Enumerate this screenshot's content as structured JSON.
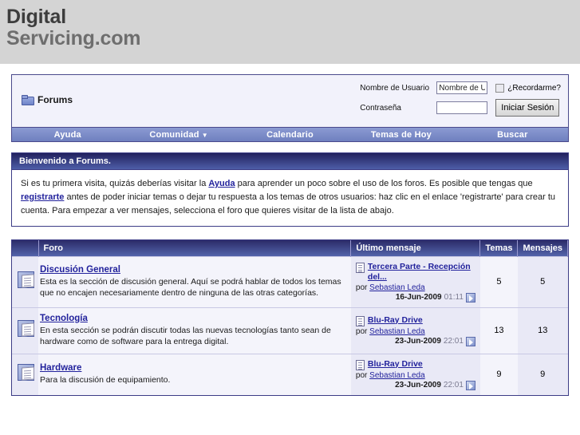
{
  "site": {
    "logo_line1": "Digital",
    "logo_line2": "Servicing.com"
  },
  "header": {
    "forums_label": "Forums",
    "folder_icon": "folder-icon"
  },
  "login": {
    "username_label": "Nombre de Usuario",
    "username_value": "Nombre de U",
    "username_placeholder": "Nombre de Usuario",
    "password_label": "Contraseña",
    "password_value": "",
    "remember_label": "¿Recordarme?",
    "submit_label": "Iniciar Sesión"
  },
  "nav": {
    "items": [
      {
        "label": "Ayuda",
        "caret": ""
      },
      {
        "label": "Comunidad",
        "caret": "▼"
      },
      {
        "label": "Calendario",
        "caret": ""
      },
      {
        "label": "Temas de Hoy",
        "caret": ""
      },
      {
        "label": "Buscar",
        "caret": ""
      }
    ]
  },
  "welcome": {
    "title": "Bienvenido a Forums.",
    "text_1": "Si es tu primera visita, quizás deberías visitar la ",
    "link_ayuda": "Ayuda",
    "text_2": " para aprender un poco sobre el uso de los foros. Es posible que tengas que ",
    "link_registrarte": "registrarte",
    "text_3": " antes de poder iniciar temas o dejar tu respuesta a los temas de otros usuarios: haz clic en el enlace 'registrarte' para crear tu cuenta. Para empezar a ver mensajes, selecciona el foro que quieres visitar de la lista de abajo."
  },
  "forum_table": {
    "headers": {
      "icon": "",
      "name": "Foro",
      "last_post": "Último mensaje",
      "topics": "Temas",
      "posts": "Mensajes"
    },
    "by_label": "por",
    "rows": [
      {
        "name": "Discusión General",
        "description": "Esta es la sección de discusión general. Aquí se podrá hablar de todos los temas que no encajen necesariamente dentro de ninguna de las otras categorías.",
        "last_post_title": "Tercera Parte - Recepción del...",
        "last_post_author": "Sebastian Leda",
        "last_post_date": "16-Jun-2009",
        "last_post_time": "01:11",
        "topics": "5",
        "posts": "5"
      },
      {
        "name": "Tecnología",
        "description": "En esta sección se podrán discutir todas las nuevas tecnologías tanto sean de hardware como de software para la entrega digital.",
        "last_post_title": "Blu-Ray Drive",
        "last_post_author": "Sebastian Leda",
        "last_post_date": "23-Jun-2009",
        "last_post_time": "22:01",
        "topics": "13",
        "posts": "13"
      },
      {
        "name": "Hardware",
        "description": "Para la discusión de equipamiento.",
        "last_post_title": "Blu-Ray Drive",
        "last_post_author": "Sebastian Leda",
        "last_post_date": "23-Jun-2009",
        "last_post_time": "22:01",
        "topics": "9",
        "posts": "9"
      }
    ]
  },
  "colors": {
    "page_bg": "#d4d4d4",
    "panel_bg": "#f2f2fb",
    "nav_blue": "#7b8bc9",
    "header_navy": "#2b2b68",
    "link_blue": "#22229c",
    "row_alt": "#e9e9f6"
  }
}
